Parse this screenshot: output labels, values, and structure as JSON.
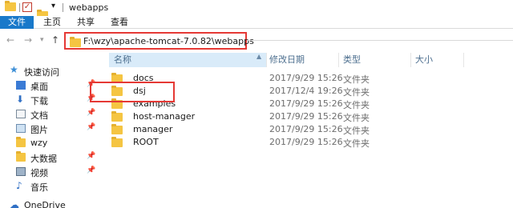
{
  "window": {
    "title": "webapps"
  },
  "ribbon": {
    "tabs": [
      "文件",
      "主页",
      "共享",
      "查看"
    ]
  },
  "address": {
    "path": "F:\\wzy\\apache-tomcat-7.0.82\\webapps"
  },
  "columns": {
    "name": "名称",
    "date": "修改日期",
    "type": "类型",
    "size": "大小"
  },
  "sidebar": {
    "items": [
      {
        "label": "快速访问",
        "icon": "star-icon",
        "pinned": false
      },
      {
        "label": "桌面",
        "icon": "desktop-icon",
        "pinned": true
      },
      {
        "label": "下载",
        "icon": "download-icon",
        "pinned": true
      },
      {
        "label": "文档",
        "icon": "document-icon",
        "pinned": true
      },
      {
        "label": "图片",
        "icon": "picture-icon",
        "pinned": true
      },
      {
        "label": "wzy",
        "icon": "folder-icon",
        "pinned": false
      },
      {
        "label": "大数据",
        "icon": "folder-icon",
        "pinned": true
      },
      {
        "label": "视频",
        "icon": "video-icon",
        "pinned": true
      },
      {
        "label": "音乐",
        "icon": "music-icon",
        "pinned": false
      },
      {
        "label": "OneDrive",
        "icon": "cloud-icon",
        "pinned": false
      }
    ]
  },
  "files": [
    {
      "name": "docs",
      "date": "2017/9/29 15:26",
      "type": "文件夹"
    },
    {
      "name": "dsj",
      "date": "2017/12/4 19:26",
      "type": "文件夹"
    },
    {
      "name": "examples",
      "date": "2017/9/29 15:26",
      "type": "文件夹"
    },
    {
      "name": "host-manager",
      "date": "2017/9/29 15:26",
      "type": "文件夹"
    },
    {
      "name": "manager",
      "date": "2017/9/29 15:26",
      "type": "文件夹"
    },
    {
      "name": "ROOT",
      "date": "2017/9/29 15:26",
      "type": "文件夹"
    }
  ],
  "colors": {
    "accent": "#1979ca",
    "highlight": "#e53935",
    "folder": "#f5c542",
    "header_bg": "#d9ebf9"
  }
}
